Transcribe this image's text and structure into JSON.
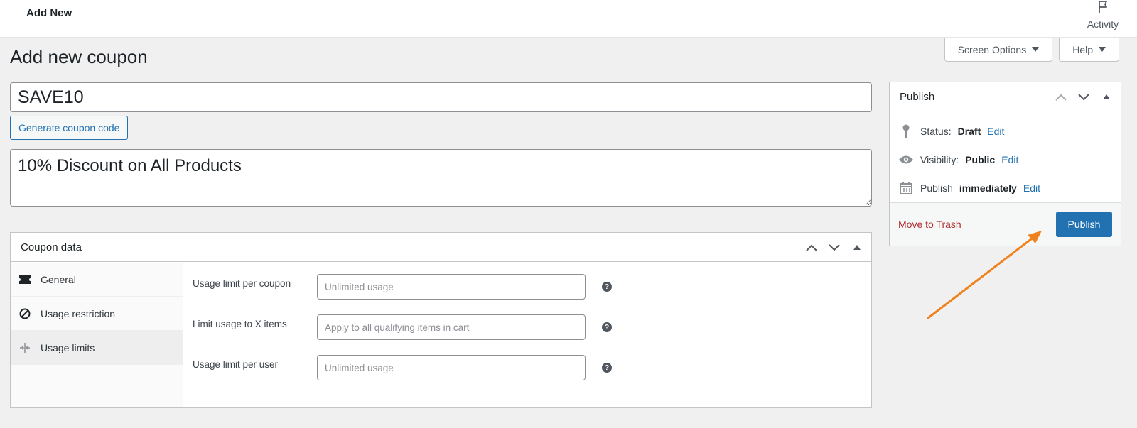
{
  "topbar": {
    "title": "Add New",
    "activity_label": "Activity",
    "activity_icon": "flag-icon"
  },
  "screen_meta": {
    "screen_options_label": "Screen Options",
    "help_label": "Help"
  },
  "page": {
    "title": "Add new coupon"
  },
  "coupon": {
    "code_value": "SAVE10",
    "generate_label": "Generate coupon code",
    "description_value": "10% Discount on All Products"
  },
  "coupon_data": {
    "title": "Coupon data",
    "tabs": [
      {
        "label": "General",
        "icon": "ticket-icon"
      },
      {
        "label": "Usage restriction",
        "icon": "restriction-icon"
      },
      {
        "label": "Usage limits",
        "icon": "limits-icon",
        "active": true
      }
    ],
    "fields": [
      {
        "label": "Usage limit per coupon",
        "placeholder": "Unlimited usage",
        "value": ""
      },
      {
        "label": "Limit usage to X items",
        "placeholder": "Apply to all qualifying items in cart",
        "value": ""
      },
      {
        "label": "Usage limit per user",
        "placeholder": "Unlimited usage",
        "value": ""
      }
    ],
    "help_glyph": "?"
  },
  "publish": {
    "title": "Publish",
    "status_label": "Status:",
    "status_value": "Draft",
    "visibility_label": "Visibility:",
    "visibility_value": "Public",
    "schedule_label": "Publish",
    "schedule_value": "immediately",
    "edit_label": "Edit",
    "trash_label": "Move to Trash",
    "publish_button_label": "Publish"
  },
  "colors": {
    "accent": "#2271b1",
    "danger": "#b32d2e",
    "annotation_arrow": "#f0821e",
    "background": "#f0f0f1"
  }
}
